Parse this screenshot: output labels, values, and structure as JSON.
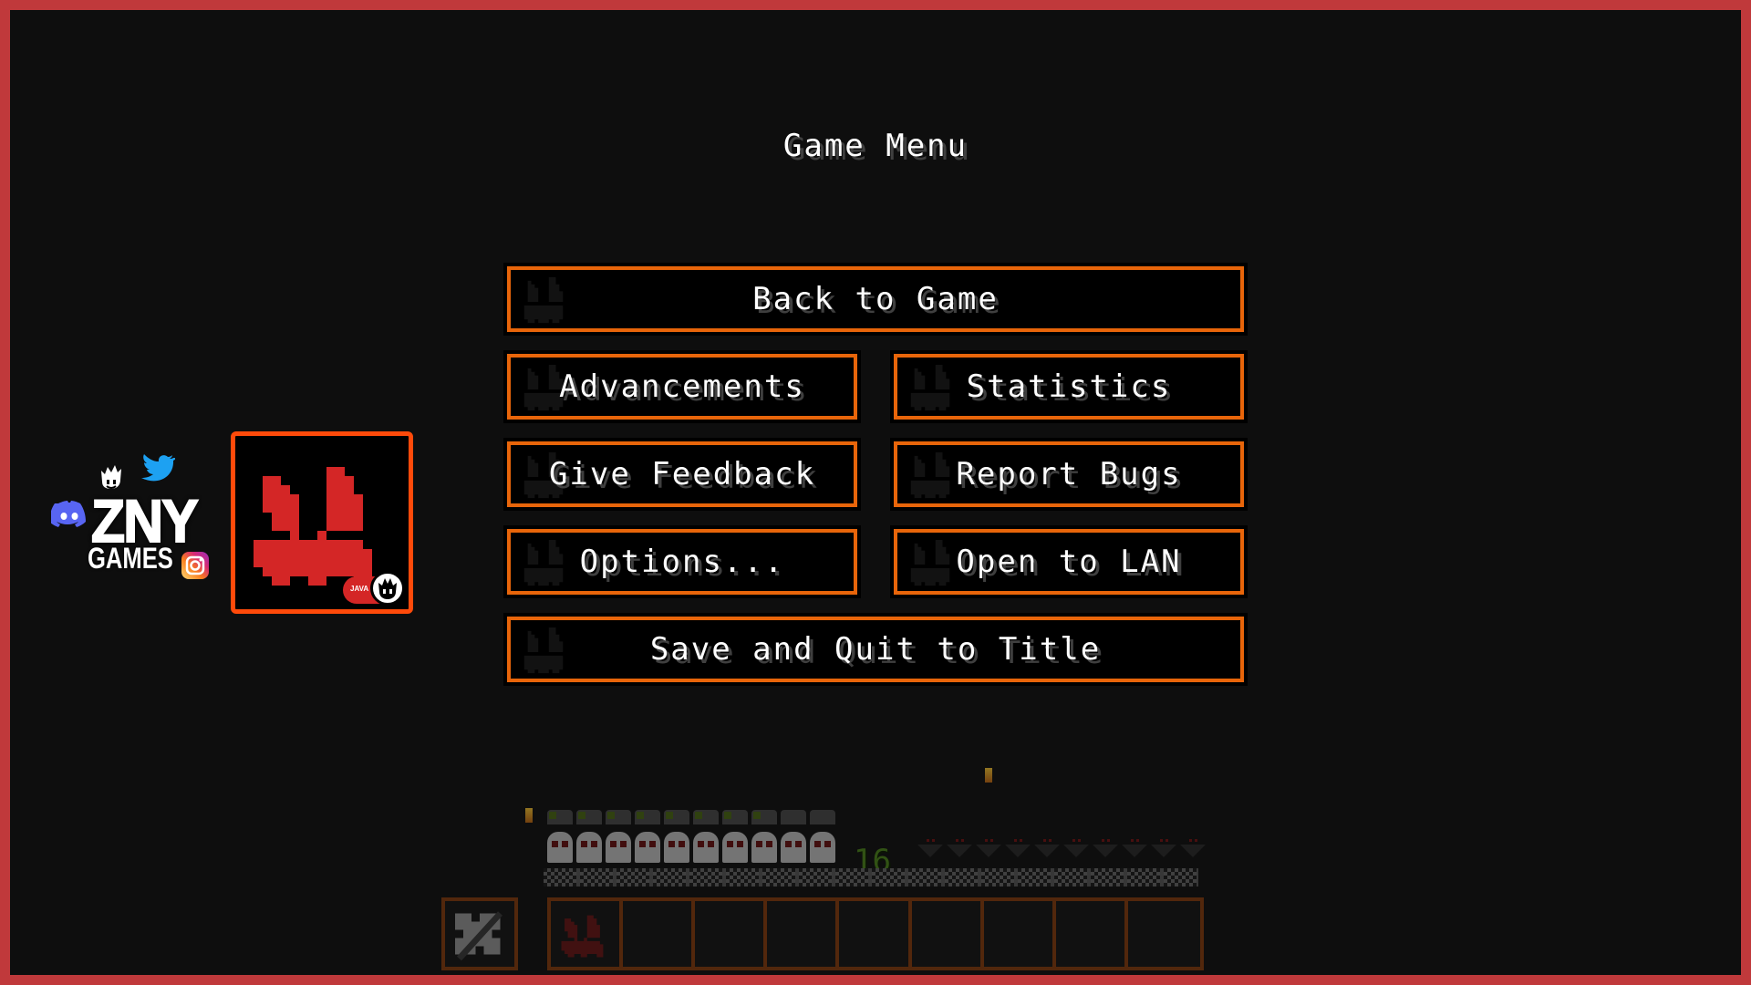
{
  "menu": {
    "title": "Game Menu",
    "buttons": {
      "back_to_game": "Back to Game",
      "advancements": "Advancements",
      "statistics": "Statistics",
      "give_feedback": "Give Feedback",
      "report_bugs": "Report Bugs",
      "options": "Options...",
      "open_to_lan": "Open to LAN",
      "save_and_quit": "Save and Quit to Title"
    },
    "button_border_color": "#e8650a"
  },
  "branding": {
    "name": "ZNY",
    "subtitle": "GAMES",
    "edition_badge": "JAVA",
    "social_icons": [
      "discord-icon",
      "twitter-icon",
      "instagram-icon"
    ],
    "logo_accent": "#d42626",
    "frame_color": "#c0393b"
  },
  "hud": {
    "xp_level": "16",
    "health_icons": 10,
    "armor_icons": 10,
    "hunger_icons": 10,
    "hotbar_slots": 9,
    "offhand_item": "sword-icon",
    "first_slot_item": "pumpkin-face-icon"
  }
}
